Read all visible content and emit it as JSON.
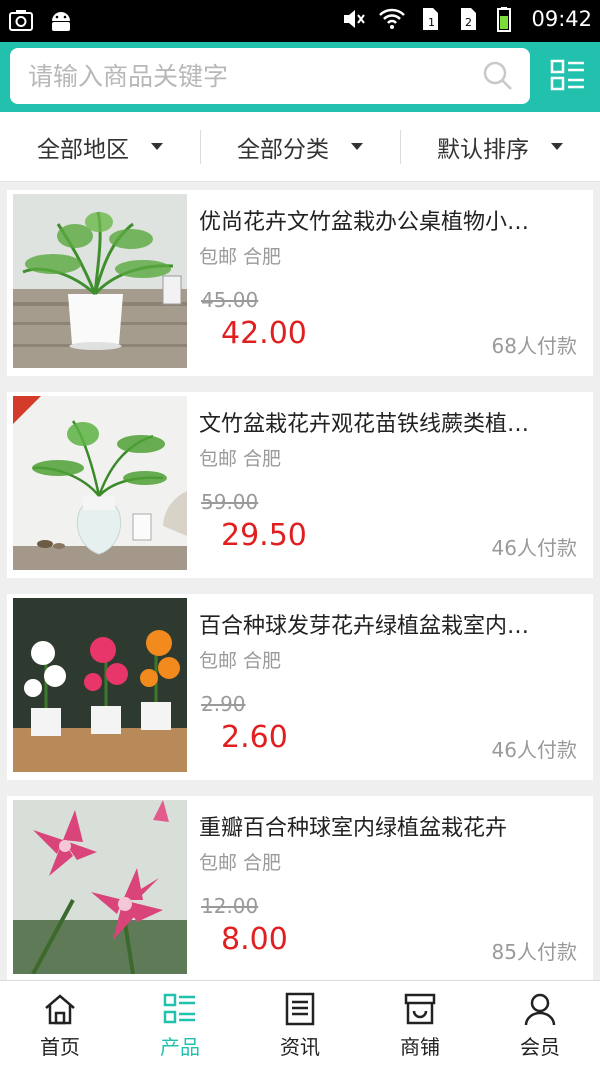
{
  "status_bar": {
    "left_icons": [
      "screenshot-icon",
      "android-icon"
    ],
    "right_icons": [
      "mute-icon",
      "wifi-icon",
      "sim1-icon",
      "sim2-icon",
      "battery-icon"
    ],
    "time": "09:42"
  },
  "header": {
    "search_placeholder": "请输入商品关键字",
    "search_icon": "search-icon",
    "menu_icon": "list-menu-icon",
    "accent_color": "#22c1ae"
  },
  "filters": [
    {
      "label": "全部地区"
    },
    {
      "label": "全部分类"
    },
    {
      "label": "默认排序"
    }
  ],
  "products": [
    {
      "title": "优尚花卉文竹盆栽办公桌植物小…",
      "tags": "包邮 合肥",
      "old_price": "45.00",
      "price": "42.00",
      "sold": "68人付款"
    },
    {
      "title": "文竹盆栽花卉观花苗铁线蕨类植…",
      "tags": "包邮 合肥",
      "old_price": "59.00",
      "price": "29.50",
      "sold": "46人付款"
    },
    {
      "title": "百合种球发芽花卉绿植盆栽室内…",
      "tags": "包邮 合肥",
      "old_price": "2.90",
      "price": "2.60",
      "sold": "46人付款"
    },
    {
      "title": "重瓣百合种球室内绿植盆栽花卉",
      "tags": "包邮 合肥",
      "old_price": "12.00",
      "price": "8.00",
      "sold": "85人付款"
    }
  ],
  "tabbar": [
    {
      "label": "首页",
      "icon": "home-icon",
      "active": false
    },
    {
      "label": "产品",
      "icon": "product-list-icon",
      "active": true
    },
    {
      "label": "资讯",
      "icon": "news-icon",
      "active": false
    },
    {
      "label": "商铺",
      "icon": "shop-icon",
      "active": false
    },
    {
      "label": "会员",
      "icon": "member-icon",
      "active": false
    }
  ],
  "price_color": "#e02020"
}
